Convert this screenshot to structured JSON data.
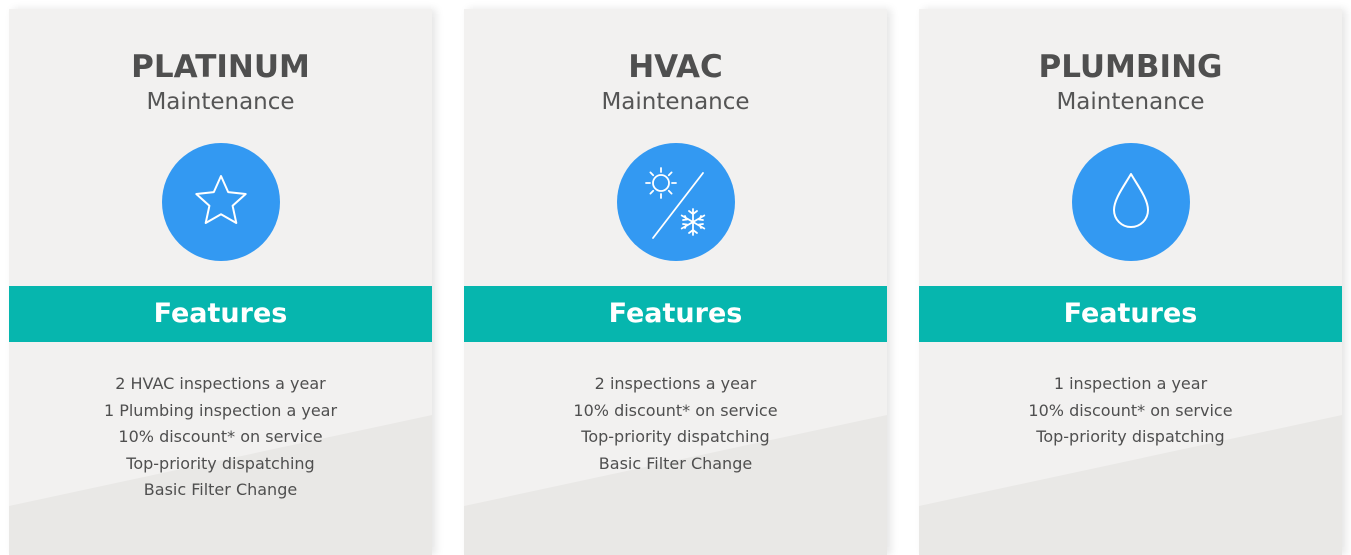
{
  "plans": [
    {
      "title": "PLATINUM",
      "subtitle": "Maintenance",
      "icon": "star-icon",
      "features_label": "Features",
      "features": [
        "2 HVAC inspections a year",
        "1 Plumbing inspection a year",
        "10% discount* on service",
        "Top-priority dispatching",
        "Basic Filter Change"
      ]
    },
    {
      "title": "HVAC",
      "subtitle": "Maintenance",
      "icon": "sun-snowflake-icon",
      "features_label": "Features",
      "features": [
        "2 inspections a year",
        "10% discount* on service",
        "Top-priority dispatching",
        "Basic Filter Change"
      ]
    },
    {
      "title": "PLUMBING",
      "subtitle": "Maintenance",
      "icon": "water-drop-icon",
      "features_label": "Features",
      "features": [
        "1 inspection a year",
        "10% discount* on service",
        "Top-priority dispatching"
      ]
    }
  ],
  "colors": {
    "card_background": "#f2f1f0",
    "icon_circle": "#3399f2",
    "features_band": "#06b6ae",
    "title_text": "#4f4f4f"
  }
}
